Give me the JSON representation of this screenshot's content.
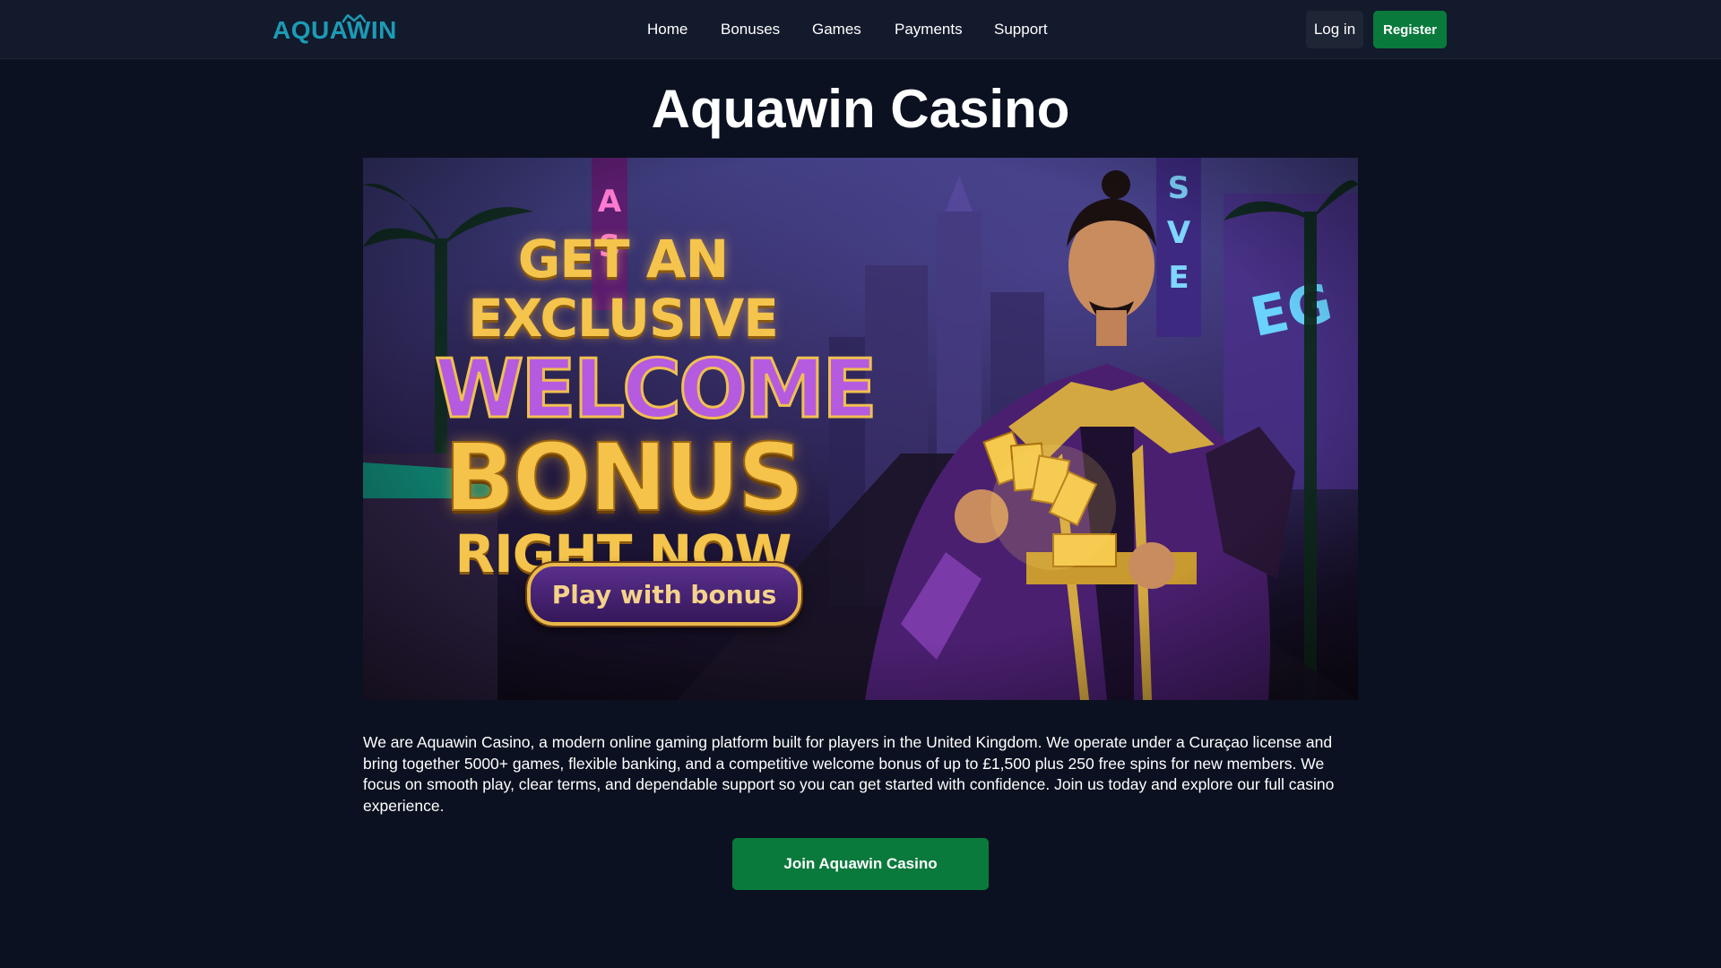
{
  "header": {
    "logo_text": "AQUAWIN",
    "nav": [
      "Home",
      "Bonuses",
      "Games",
      "Payments",
      "Support"
    ],
    "login_label": "Log in",
    "register_label": "Register"
  },
  "main": {
    "title": "Aquawin Casino",
    "banner": {
      "line1": "GET AN EXCLUSIVE",
      "line2": "WELCOME",
      "line3": "BONUS",
      "line4": "RIGHT NOW",
      "cta_label": "Play with bonus"
    },
    "intro": "We are Aquawin Casino, a modern online gaming platform built for players in the United Kingdom. We operate under a Curaçao license and bring together 5000+ games, flexible banking, and a competitive welcome bonus of up to £1,500 plus 250 free spins for new members. We focus on smooth play, clear terms, and dependable support so you can get started with confidence. Join us today and explore our full casino experience.",
    "join_label": "Join Aquawin Casino"
  },
  "colors": {
    "page_bg": "#0b1120",
    "header_bg": "#131a2c",
    "logo": "#1c9bb5",
    "accent_green": "#0a7a3c",
    "login_bg": "#1e2535"
  }
}
